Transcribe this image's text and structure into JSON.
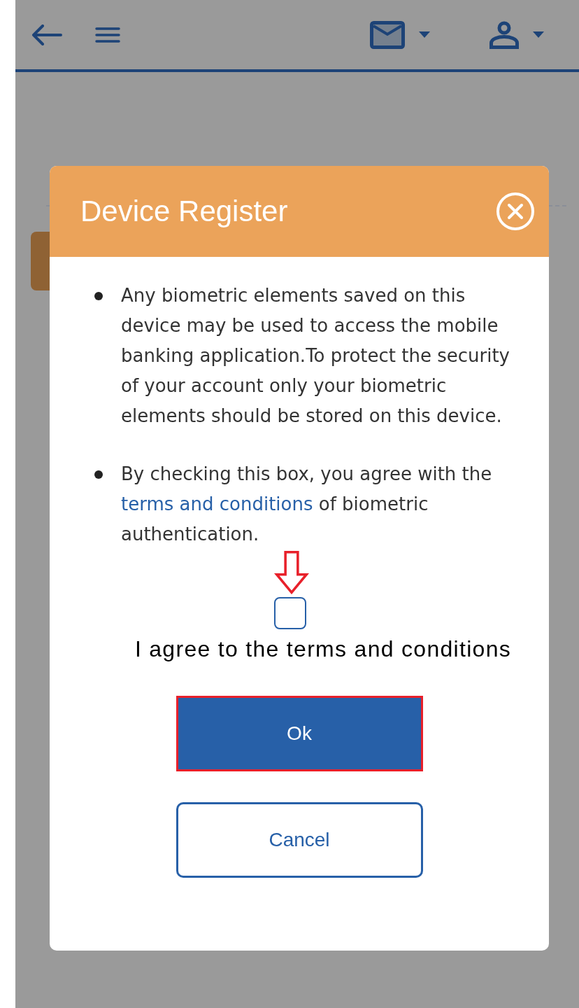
{
  "dialog": {
    "title": "Device Register",
    "bullets": [
      {
        "text": "Any biometric elements saved on this device may be used to access the mobile banking application.To protect the security of your account only your biometric elements should be stored on this device."
      },
      {
        "text": "By checking this box, you agree with the ",
        "link": "terms and conditions",
        "text_after": " of biometric authentication."
      }
    ],
    "checkbox": {
      "label": "I agree to the terms and conditions",
      "checked": false
    },
    "buttons": [
      {
        "label": "Ok",
        "kind": "primary",
        "highlighted": true
      },
      {
        "label": "Cancel",
        "kind": "secondary",
        "highlighted": false
      }
    ]
  }
}
